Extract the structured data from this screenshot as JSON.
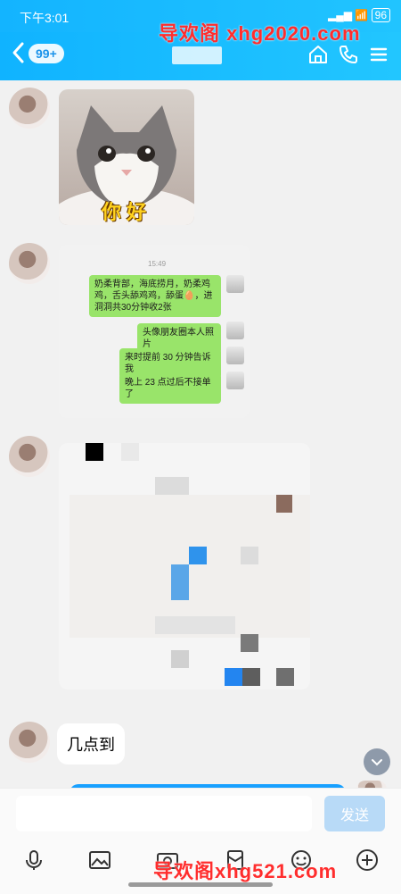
{
  "status_bar": {
    "time": "下午3:01",
    "battery": "96"
  },
  "header": {
    "unread_badge": "99+"
  },
  "watermarks": {
    "top": "导欢阁 xhg2020.com",
    "bottom": "导欢阁xhg521.com"
  },
  "messages": [
    {
      "type": "image",
      "caption": "你 好"
    },
    {
      "type": "screenshot",
      "time": "15:49",
      "lines": [
        "奶柔背部，海底捞月，奶柔鸡鸡，舌头舔鸡鸡，舔蛋🥚，进洞洞共30分钟收2张",
        "头像朋友圈本人照片",
        "来时提前 30 分钟告诉我",
        "晚上 23 点过后不接单了"
      ]
    },
    {
      "type": "pixelated-image"
    },
    {
      "type": "text",
      "text": "几点到"
    }
  ],
  "composer": {
    "send_label": "发送"
  },
  "icons": {
    "back": "back-chevron-icon",
    "home": "home-icon",
    "phone": "phone-icon",
    "menu": "menu-icon",
    "voice": "microphone-icon",
    "gallery": "image-icon",
    "emoji": "emoji-icon",
    "plus": "plus-icon"
  },
  "colors": {
    "accent": "#13b4ff",
    "bubble_green": "#99e46a",
    "send_disabled": "#b8daf7"
  }
}
